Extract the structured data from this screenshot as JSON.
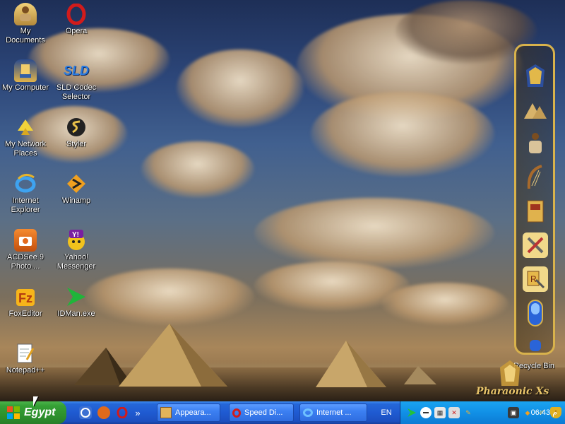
{
  "desktop": {
    "icons": [
      {
        "label": "My\nDocuments",
        "icon": "my-documents-icon"
      },
      {
        "label": "Opera",
        "icon": "opera-icon"
      },
      {
        "label": "My Computer",
        "icon": "my-computer-icon"
      },
      {
        "label": "SLD Codec\nSelector",
        "icon": "sld-codec-icon",
        "glyph": "SLD"
      },
      {
        "label": "My Network\nPlaces",
        "icon": "network-places-icon"
      },
      {
        "label": "Styler",
        "icon": "styler-icon"
      },
      {
        "label": "Internet\nExplorer",
        "icon": "internet-explorer-icon"
      },
      {
        "label": "Winamp",
        "icon": "winamp-icon"
      },
      {
        "label": "ACDSee 9\nPhoto ...",
        "icon": "acdsee-icon"
      },
      {
        "label": "Yahoo!\nMessenger",
        "icon": "yahoo-messenger-icon"
      },
      {
        "label": "FoxEditor",
        "icon": "foxeditor-icon"
      },
      {
        "label": "IDMan.exe",
        "icon": "idman-icon"
      },
      {
        "label": "Notepad++",
        "icon": "notepadpp-icon"
      },
      {
        "label": "Recycle Bin",
        "icon": "recycle-bin-icon"
      }
    ],
    "logo_text": "Pharaonic Xs"
  },
  "taskbar": {
    "start_label": "Egypt",
    "quick_launch_more": "»",
    "tasks": [
      {
        "label": "Appeara...",
        "icon": "appearance-icon"
      },
      {
        "label": "Speed Di...",
        "icon": "opera-icon"
      },
      {
        "label": "Internet ...",
        "icon": "internet-explorer-icon"
      }
    ],
    "language": "EN",
    "clock": "06:43 م"
  },
  "colors": {
    "taskbar_blue": "#1f5ad1",
    "start_green": "#35a035",
    "tray_blue": "#1190e6",
    "dock_gold": "#d8b24c"
  }
}
